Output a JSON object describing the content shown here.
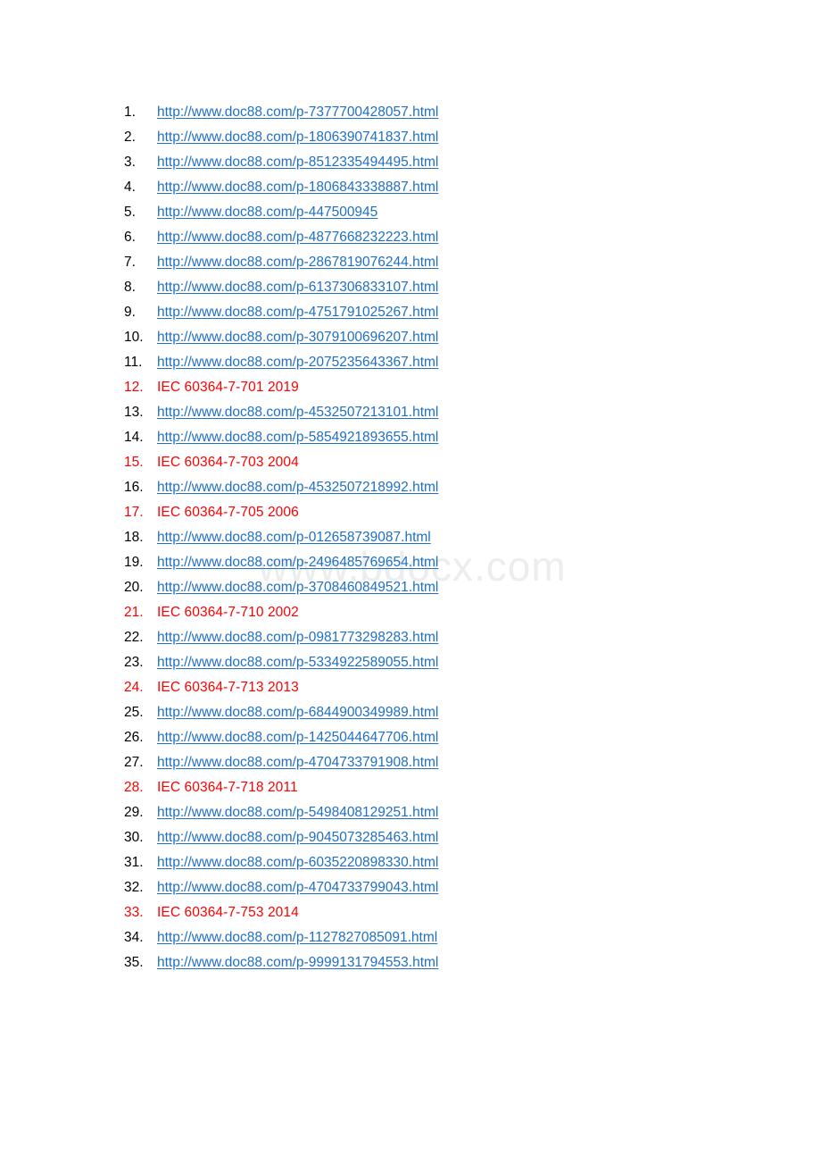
{
  "document": {
    "watermark": "www.bdocx.com",
    "link_color": "#1f6fc4",
    "reference_color": "#ff0000",
    "text_color": "#000000",
    "page_background": "#ffffff"
  },
  "list": {
    "items": [
      {
        "number": "1.",
        "type": "link",
        "text": "http://www.doc88.com/p-7377700428057.html"
      },
      {
        "number": "2.",
        "type": "link",
        "text": "http://www.doc88.com/p-1806390741837.html"
      },
      {
        "number": "3.",
        "type": "link",
        "text": "http://www.doc88.com/p-8512335494495.html"
      },
      {
        "number": "4.",
        "type": "link",
        "text": "http://www.doc88.com/p-1806843338887.html"
      },
      {
        "number": "5.",
        "type": "link",
        "text": "http://www.doc88.com/p-447500945"
      },
      {
        "number": "6.",
        "type": "link",
        "text": "http://www.doc88.com/p-4877668232223.html"
      },
      {
        "number": "7.",
        "type": "link",
        "text": "http://www.doc88.com/p-2867819076244.html"
      },
      {
        "number": "8.",
        "type": "link",
        "text": "http://www.doc88.com/p-6137306833107.html"
      },
      {
        "number": "9.",
        "type": "link",
        "text": "http://www.doc88.com/p-4751791025267.html"
      },
      {
        "number": "10.",
        "type": "link",
        "text": "http://www.doc88.com/p-3079100696207.html"
      },
      {
        "number": "11.",
        "type": "link",
        "text": "http://www.doc88.com/p-2075235643367.html"
      },
      {
        "number": "12.",
        "type": "reference",
        "text": "IEC 60364-7-701 2019"
      },
      {
        "number": "13.",
        "type": "link",
        "text": "http://www.doc88.com/p-4532507213101.html"
      },
      {
        "number": "14.",
        "type": "link",
        "text": "http://www.doc88.com/p-5854921893655.html"
      },
      {
        "number": "15.",
        "type": "reference",
        "text": "IEC 60364-7-703 2004"
      },
      {
        "number": "16.",
        "type": "link",
        "text": "http://www.doc88.com/p-4532507218992.html"
      },
      {
        "number": "17.",
        "type": "reference",
        "text": "IEC 60364-7-705 2006"
      },
      {
        "number": "18.",
        "type": "link",
        "text": "http://www.doc88.com/p-012658739087.html"
      },
      {
        "number": "19.",
        "type": "link",
        "text": "http://www.doc88.com/p-2496485769654.html"
      },
      {
        "number": "20.",
        "type": "link",
        "text": "http://www.doc88.com/p-3708460849521.html"
      },
      {
        "number": "21.",
        "type": "reference",
        "text": "IEC 60364-7-710 2002"
      },
      {
        "number": "22.",
        "type": "link",
        "text": "http://www.doc88.com/p-0981773298283.html"
      },
      {
        "number": "23.",
        "type": "link",
        "text": "http://www.doc88.com/p-5334922589055.html"
      },
      {
        "number": "24.",
        "type": "reference",
        "text": "IEC 60364-7-713 2013"
      },
      {
        "number": "25.",
        "type": "link",
        "text": "http://www.doc88.com/p-6844900349989.html"
      },
      {
        "number": "26.",
        "type": "link",
        "text": "http://www.doc88.com/p-1425044647706.html"
      },
      {
        "number": "27.",
        "type": "link",
        "text": "http://www.doc88.com/p-4704733791908.html"
      },
      {
        "number": "28.",
        "type": "reference",
        "text": "IEC 60364-7-718 2011"
      },
      {
        "number": "29.",
        "type": "link",
        "text": "http://www.doc88.com/p-5498408129251.html"
      },
      {
        "number": "30.",
        "type": "link",
        "text": "http://www.doc88.com/p-9045073285463.html"
      },
      {
        "number": "31.",
        "type": "link",
        "text": "http://www.doc88.com/p-6035220898330.html"
      },
      {
        "number": "32.",
        "type": "link",
        "text": "http://www.doc88.com/p-4704733799043.html"
      },
      {
        "number": "33.",
        "type": "reference",
        "text": "IEC 60364-7-753 2014"
      },
      {
        "number": "34.",
        "type": "link",
        "text": "http://www.doc88.com/p-1127827085091.html"
      },
      {
        "number": "35.",
        "type": "link",
        "text": "http://www.doc88.com/p-9999131794553.html"
      }
    ]
  }
}
